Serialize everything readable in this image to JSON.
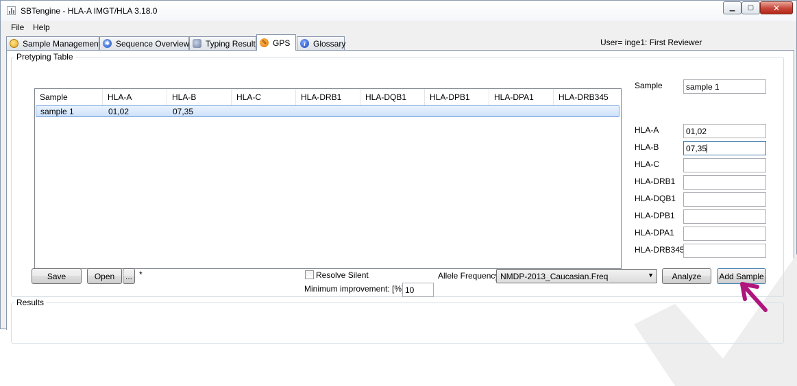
{
  "window": {
    "title": "SBTengine - HLA-A IMGT/HLA 3.18.0",
    "minimize": "▁",
    "maximize": "▢",
    "close": "✕"
  },
  "menu": [
    "File",
    "Help"
  ],
  "tabs": [
    {
      "label": "Sample Management",
      "icon": "sample-management-icon",
      "active": false
    },
    {
      "label": "Sequence Overview",
      "icon": "sequence-overview-icon",
      "active": false
    },
    {
      "label": "Typing Result",
      "icon": "typing-result-icon",
      "active": false
    },
    {
      "label": "GPS",
      "icon": "gps-icon",
      "active": true
    },
    {
      "label": "Glossary",
      "icon": "glossary-icon",
      "active": false
    }
  ],
  "user_label": "User= inge1: First Reviewer",
  "pretyping": {
    "title": "Pretyping Table",
    "columns": [
      "Sample",
      "HLA-A",
      "HLA-B",
      "HLA-C",
      "HLA-DRB1",
      "HLA-DQB1",
      "HLA-DPB1",
      "HLA-DPA1",
      "HLA-DRB345"
    ],
    "rows": [
      [
        "sample 1",
        "01,02",
        "07,35",
        "",
        "",
        "",
        "",
        "",
        ""
      ]
    ],
    "fields": {
      "sample_label": "Sample",
      "sample_value": "sample 1",
      "loci": [
        {
          "label": "HLA-A",
          "value": "01,02"
        },
        {
          "label": "HLA-B",
          "value": "07,35"
        },
        {
          "label": "HLA-C",
          "value": ""
        },
        {
          "label": "HLA-DRB1",
          "value": ""
        },
        {
          "label": "HLA-DQB1",
          "value": ""
        },
        {
          "label": "HLA-DPB1",
          "value": ""
        },
        {
          "label": "HLA-DPA1",
          "value": ""
        },
        {
          "label": "HLA-DRB345",
          "value": ""
        }
      ]
    },
    "buttons": {
      "save": "Save",
      "open": "Open",
      "browse": "...",
      "modified": "*",
      "analyze": "Analyze",
      "add_sample": "Add Sample"
    },
    "resolve_silent": {
      "label": "Resolve Silent",
      "checked": false
    },
    "min_improvement": {
      "label": "Minimum improvement: [%]",
      "value": "10"
    },
    "allele_frequency": {
      "label": "Allele Frequency:",
      "value": "NMDP-2013_Caucasian.Freq"
    }
  },
  "results": {
    "title": "Results"
  },
  "colors": {
    "accent_arrow": "#b0157e",
    "selection": "#cde2fb"
  }
}
